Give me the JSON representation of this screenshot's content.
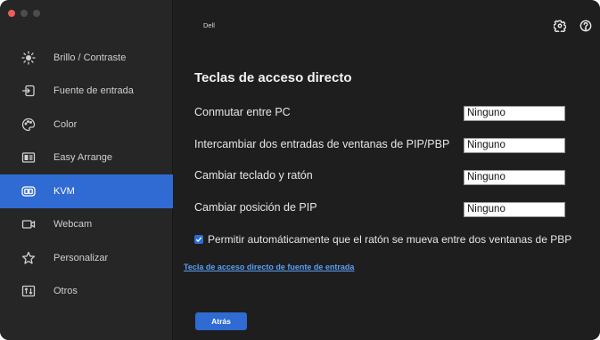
{
  "window": {
    "brand": "Dell"
  },
  "sidebar": {
    "items": [
      {
        "label": "Brillo / Contraste",
        "icon": "brightness-icon"
      },
      {
        "label": "Fuente de entrada",
        "icon": "input-source-icon"
      },
      {
        "label": "Color",
        "icon": "color-palette-icon"
      },
      {
        "label": "Easy Arrange",
        "icon": "easy-arrange-icon"
      },
      {
        "label": "KVM",
        "icon": "kvm-icon",
        "active": true
      },
      {
        "label": "Webcam",
        "icon": "webcam-icon"
      },
      {
        "label": "Personalizar",
        "icon": "star-icon"
      },
      {
        "label": "Otros",
        "icon": "other-icon"
      }
    ]
  },
  "header": {
    "icons": [
      "gear-icon",
      "help-icon"
    ]
  },
  "main": {
    "title": "Teclas de acceso directo",
    "rows": [
      {
        "label": "Conmutar entre PC",
        "value": "Ninguno"
      },
      {
        "label": "Intercambiar dos entradas de ventanas de PIP/PBP",
        "value": "Ninguno"
      },
      {
        "label": "Cambiar teclado y ratón",
        "value": "Ninguno"
      },
      {
        "label": "Cambiar posición de PIP",
        "value": "Ninguno"
      }
    ],
    "checkbox_label": "Permitir automáticamente que el ratón se mueva entre dos ventanas de PBP",
    "checkbox_checked": true,
    "link_text": "Tecla de acceso directo de fuente de entrada",
    "back_button": "Atrás"
  },
  "colors": {
    "accent": "#2f6bd3",
    "link": "#5b9ef5",
    "background": "#1e1e1e",
    "sidebar": "#262626"
  }
}
